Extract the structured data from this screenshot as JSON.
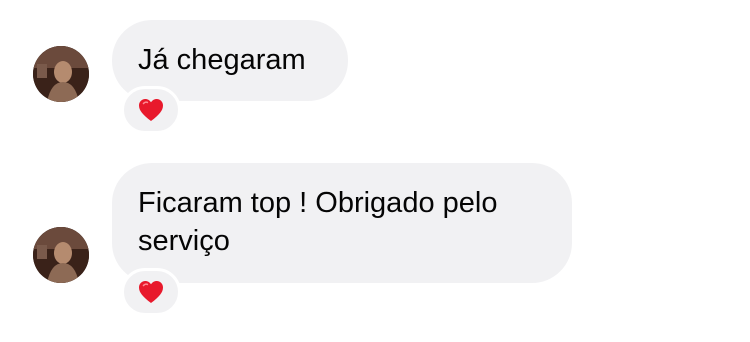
{
  "messages": [
    {
      "text": "Já chegaram",
      "reaction": "heart-icon"
    },
    {
      "text": "Ficaram top ! Obrigado pelo serviço",
      "reaction": "heart-icon"
    }
  ],
  "colors": {
    "bubble_background": "#f1f1f3",
    "text": "#050505",
    "heart": "#e8192c"
  }
}
